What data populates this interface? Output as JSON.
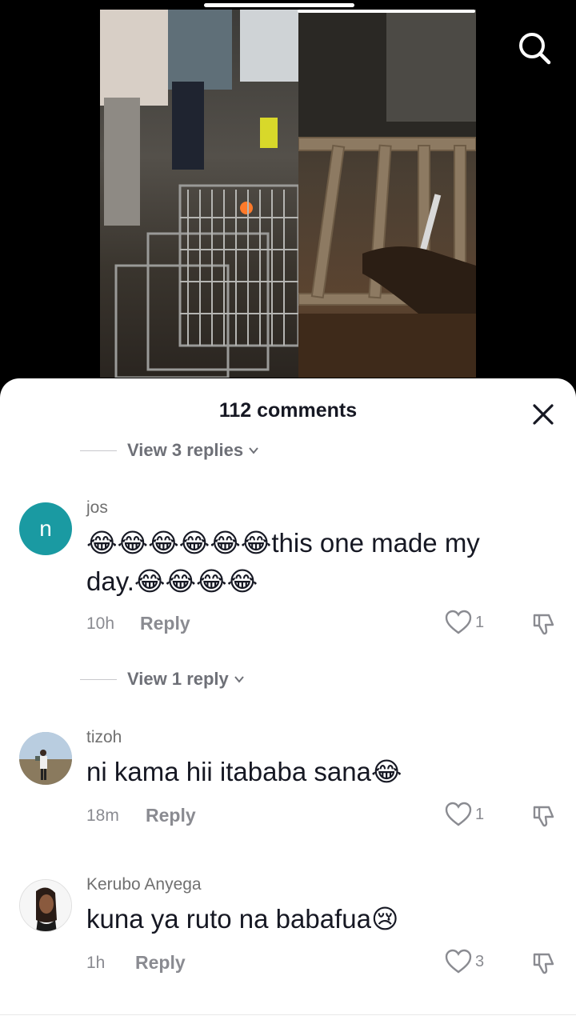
{
  "video": {
    "progress_fraction": 0.5
  },
  "header": {
    "search_icon": "search-icon"
  },
  "sheet": {
    "title": "112 comments",
    "close_icon": "close-icon"
  },
  "reply_toggles": [
    {
      "label": "View 3 replies"
    },
    {
      "label": "View 1 reply"
    }
  ],
  "comments": [
    {
      "username": "jos",
      "avatar_letter": "n",
      "text_line1": "😂😂😂😂😂😂this one made my",
      "text_line2": "day.😂😂😂😂",
      "time": "10h",
      "reply_label": "Reply",
      "likes": "1"
    },
    {
      "username": "tizoh",
      "text": "ni kama hii itababa sana😂",
      "time": "18m",
      "reply_label": "Reply",
      "likes": "1"
    },
    {
      "username": "Kerubo Anyega",
      "text": "kuna ya ruto na babafua😢",
      "time": "1h",
      "reply_label": "Reply",
      "likes": "3"
    }
  ],
  "colors": {
    "accent_avatar": "#1a9aa2",
    "text_primary": "#161823",
    "text_secondary": "#8a8b91"
  }
}
